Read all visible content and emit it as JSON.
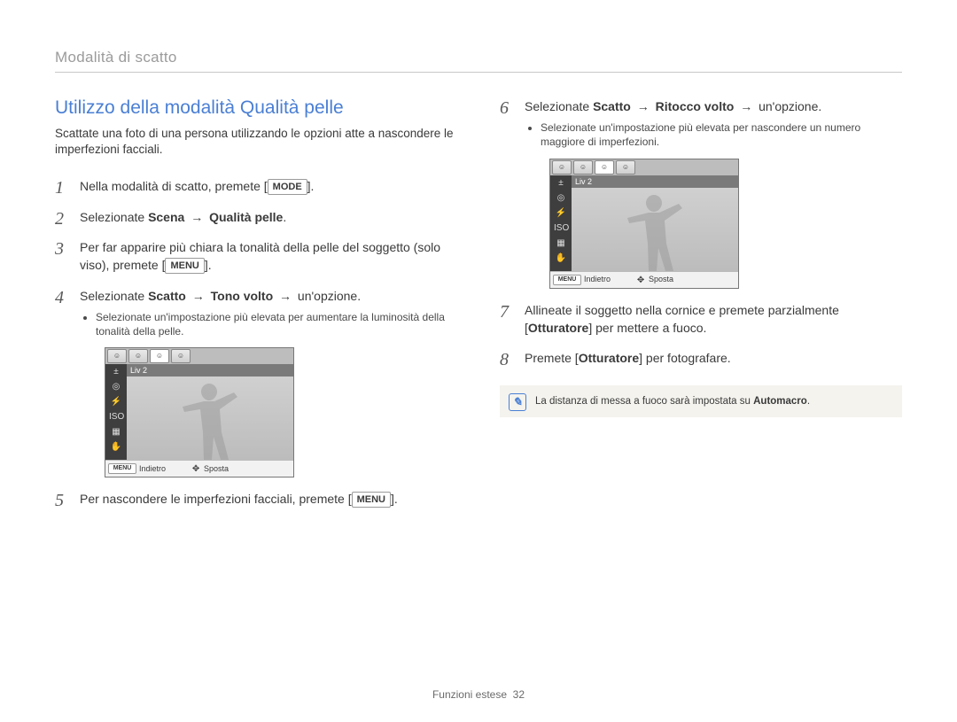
{
  "chapter": "Modalità di scatto",
  "section_title": "Utilizzo della modalità Qualità pelle",
  "intro": "Scattate una foto di una persona utilizzando le opzioni atte a nascondere le imperfezioni facciali.",
  "keys": {
    "mode": "MODE",
    "menu": "MENU",
    "menu_small": "MENU"
  },
  "arrow": "→",
  "steps_left": {
    "s1_a": "Nella modalità di scatto, premete [",
    "s1_b": "].",
    "s2_a": "Selezionate ",
    "s2_bold1": "Scena",
    "s2_bold2": "Qualità pelle",
    "s2_end": ".",
    "s3_a": "Per far apparire più chiara la tonalità della pelle del soggetto (solo viso), premete [",
    "s3_b": "].",
    "s4_a": "Selezionate ",
    "s4_bold1": "Scatto",
    "s4_bold2": "Tono volto",
    "s4_b": " un'opzione.",
    "s4_sub": "Selezionate un'impostazione più elevata per aumentare la luminosità della tonalità della pelle.",
    "s5_a": "Per nascondere le imperfezioni facciali, premete [",
    "s5_b": "]."
  },
  "steps_right": {
    "s6_a": "Selezionate ",
    "s6_bold1": "Scatto",
    "s6_bold2": "Ritocco volto",
    "s6_b": " un'opzione.",
    "s6_sub": "Selezionate un'impostazione più elevata per nascondere un numero maggiore di imperfezioni.",
    "s7_a": "Allineate il soggetto nella cornice e premete parzialmente [",
    "s7_bold": "Otturatore",
    "s7_b": "] per mettere a fuoco.",
    "s8_a": "Premete [",
    "s8_bold": "Otturatore",
    "s8_b": "] per fotografare."
  },
  "note": {
    "text_a": "La distanza di messa a fuoco sarà impostata su ",
    "text_bold": "Automacro",
    "text_b": "."
  },
  "camera": {
    "level_label": "Liv 2",
    "back": "Indietro",
    "move": "Sposta"
  },
  "footer": {
    "label": "Funzioni estese",
    "page": "32"
  }
}
